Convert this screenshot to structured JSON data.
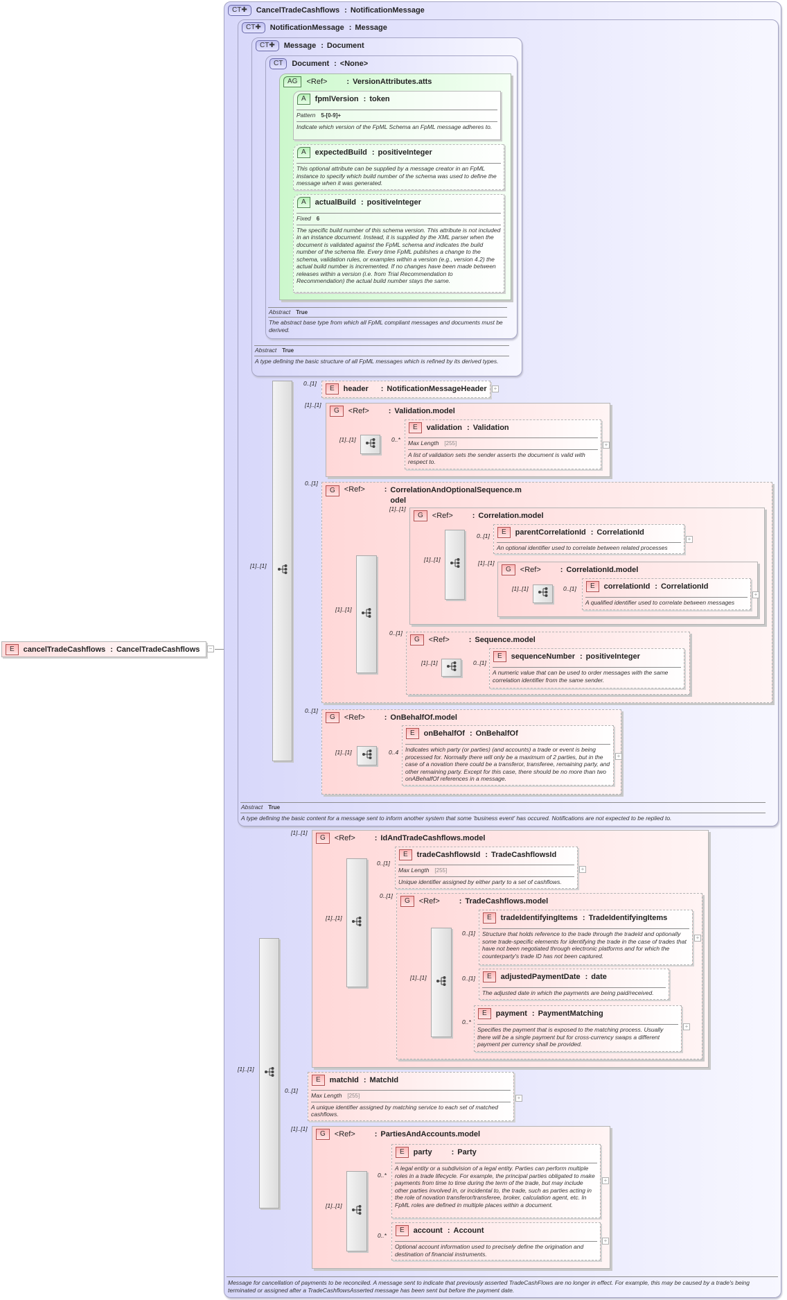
{
  "labels": {
    "sep": ":",
    "abstract": "Abstract",
    "true": "True",
    "max_length": "Max Length",
    "max_length_value": "[255]",
    "plus": "+",
    "minus": "−"
  },
  "root": {
    "badge": "E",
    "name": "cancelTradeCashflows",
    "type": "CancelTradeCashflows"
  },
  "ct_cancel": {
    "badge": "CT✚",
    "name": "CancelTradeCashflows",
    "type": "NotificationMessage",
    "description": "Message for cancellation of payments to be reconciled. A message sent to indicate that previously asserted TradeCashFlows are no longer in effect. For example, this may be caused by a trade's being terminated or assigned after a TradeCashflowsAsserted message has been sent but before the payment date."
  },
  "ct_notification": {
    "badge": "CT✚",
    "name": "NotificationMessage",
    "type": "Message",
    "description": "A type defining the basic content for a message sent to inform another system that some 'business event' has occured. Notifications are not expected to be replied to."
  },
  "ct_message": {
    "badge": "CT✚",
    "name": "Message",
    "type": "Document",
    "description": "A type defining the basic structure of all FpML messages which is refined by its derived types."
  },
  "ct_document": {
    "badge": "CT",
    "name": "Document",
    "type": "<None>",
    "description": "The abstract base type from which all FpML compliant messages and documents must be derived."
  },
  "ag_version": {
    "badge": "AG",
    "ref": "<Ref>",
    "type": "VersionAttributes.atts"
  },
  "attr_fpml": {
    "badge": "A",
    "name": "fpmlVersion",
    "type": "token",
    "facet_label": "Pattern",
    "facet_value": "5-[0-9]+",
    "description": "Indicate which version of the FpML Schema an FpML message adheres to."
  },
  "attr_expected": {
    "badge": "A",
    "name": "expectedBuild",
    "type": "positiveInteger",
    "description": "This optional attribute can be supplied by a message creator in an FpML instance to specify which build number of the schema was used to define the message when it was generated."
  },
  "attr_actual": {
    "badge": "A",
    "name": "actualBuild",
    "type": "positiveInteger",
    "facet_label": "Fixed",
    "facet_value": "6",
    "description": "The specific build number of this schema version. This attribute is not included in an instance document. Instead, it is supplied by the XML parser when the document is validated against the FpML schema and indicates the build number of the schema file. Every time FpML publishes a change to the schema, validation rules, or examples within a version (e.g., version 4.2) the actual build number is incremented. If no changes have been made between releases within a version (i.e. from Trial Recommendation to Recommendation) the actual build number stays the same."
  },
  "seq_notification": {
    "card": "[1]..[1]"
  },
  "header_el": {
    "badge": "E",
    "name": "header",
    "type": "NotificationMessageHeader",
    "card": "0..[1]"
  },
  "g_validation": {
    "badge": "G",
    "ref": "<Ref>",
    "type": "Validation.model",
    "card": "[1]..[1]",
    "seq_card": "[1]..[1]"
  },
  "validation_el": {
    "badge": "E",
    "name": "validation",
    "type": "Validation",
    "card": "0..*",
    "description": "A list of validation sets the sender asserts the document is valid with respect to."
  },
  "g_corr_opt": {
    "badge": "G",
    "ref": "<Ref>",
    "type_line1": "CorrelationAndOptionalSequence.m",
    "type_line2": "odel",
    "card": "0..[1]",
    "seq_card": "[1]..[1]"
  },
  "g_correlation": {
    "badge": "G",
    "ref": "<Ref>",
    "type": "Correlation.model",
    "card": "[1]..[1]",
    "seq_card": "[1]..[1]"
  },
  "parent_corr_el": {
    "badge": "E",
    "name": "parentCorrelationId",
    "type": "CorrelationId",
    "card": "0..[1]",
    "description": "An optional identifier used to correlate between related processes"
  },
  "g_corr_id": {
    "badge": "G",
    "ref": "<Ref>",
    "type": "CorrelationId.model",
    "card": "[1]..[1]",
    "seq_card": "[1]..[1]"
  },
  "corr_id_el": {
    "badge": "E",
    "name": "correlationId",
    "type": "CorrelationId",
    "card": "0..[1]",
    "description": "A qualified identifier used to correlate between messages"
  },
  "g_sequence": {
    "badge": "G",
    "ref": "<Ref>",
    "type": "Sequence.model",
    "card": "0..[1]",
    "seq_card": "[1]..[1]"
  },
  "seq_number_el": {
    "badge": "E",
    "name": "sequenceNumber",
    "type": "positiveInteger",
    "card": "0..[1]",
    "description": "A numeric value that can be used to order messages with the same correlation identifier from the same sender."
  },
  "g_on_behalf": {
    "badge": "G",
    "ref": "<Ref>",
    "type": "OnBehalfOf.model",
    "card": "0..[1]",
    "seq_card": "[1]..[1]"
  },
  "on_behalf_el": {
    "badge": "E",
    "name": "onBehalfOf",
    "type": "OnBehalfOf",
    "card": "0..4",
    "description": "Indicates which party (or parties) (and accounts) a trade or event is being processed for. Normally there will only be a maximum of 2 parties, but in the case of a novation there could be a transferor, transferee, remaining party, and other remaining party. Except for this case, there should be no more than two onABehalfOf references in a message."
  },
  "seq_cancel": {
    "card": "[1]..[1]"
  },
  "g_id_trade": {
    "badge": "G",
    "ref": "<Ref>",
    "type": "IdAndTradeCashflows.model",
    "card": "[1]..[1]",
    "seq_card": "[1]..[1]"
  },
  "trade_cf_id_el": {
    "badge": "E",
    "name": "tradeCashflowsId",
    "type": "TradeCashflowsId",
    "card": "0..[1]",
    "description": "Unique identifier assigned by either party to a set of cashflows."
  },
  "g_trade_cf": {
    "badge": "G",
    "ref": "<Ref>",
    "type": "TradeCashflows.model",
    "card": "0..[1]",
    "seq_card": "[1]..[1]"
  },
  "trade_ident_el": {
    "badge": "E",
    "name": "tradeIdentifyingItems",
    "type": "TradeIdentifyingItems",
    "card": "0..[1]",
    "description": "Structure that holds reference to the trade through the tradeId and optionally some trade-specific elements for identifying the trade in the case of trades that have not been negotiated through electronic platforms and for which the counterparty's trade ID has not been captured."
  },
  "adj_date_el": {
    "badge": "E",
    "name": "adjustedPaymentDate",
    "type": "date",
    "card": "0..[1]",
    "description": "The adjusted date in which the payments are being paid/received."
  },
  "payment_el": {
    "badge": "E",
    "name": "payment",
    "type": "PaymentMatching",
    "card": "0..*",
    "description": "Specifies the payment that is exposed to the matching process. Usually there will be a single payment but for cross-currency swaps a different payment per currency shall be provided."
  },
  "match_id_el": {
    "badge": "E",
    "name": "matchId",
    "type": "MatchId",
    "card": "0..[1]",
    "description": "A unique identifier assigned by matching service to each set of matched cashflows."
  },
  "g_parties": {
    "badge": "G",
    "ref": "<Ref>",
    "type": "PartiesAndAccounts.model",
    "card": "[1]..[1]",
    "seq_card": "[1]..[1]"
  },
  "party_el": {
    "badge": "E",
    "name": "party",
    "type": "Party",
    "card": "0..*",
    "description": "A legal entity or a subdivision of a legal entity. Parties can perform multiple roles in a trade lifecycle. For example, the principal parties obligated to make payments from time to time during the term of the trade, but may include other parties involved in, or incidental to, the trade, such as parties acting in the role of novation transferor/transferee, broker, calculation agent, etc. In FpML roles are defined in multiple places within a document."
  },
  "account_el": {
    "badge": "E",
    "name": "account",
    "type": "Account",
    "card": "0..*",
    "description": "Optional account information used to precisely define the origination and destination of financial instruments."
  }
}
